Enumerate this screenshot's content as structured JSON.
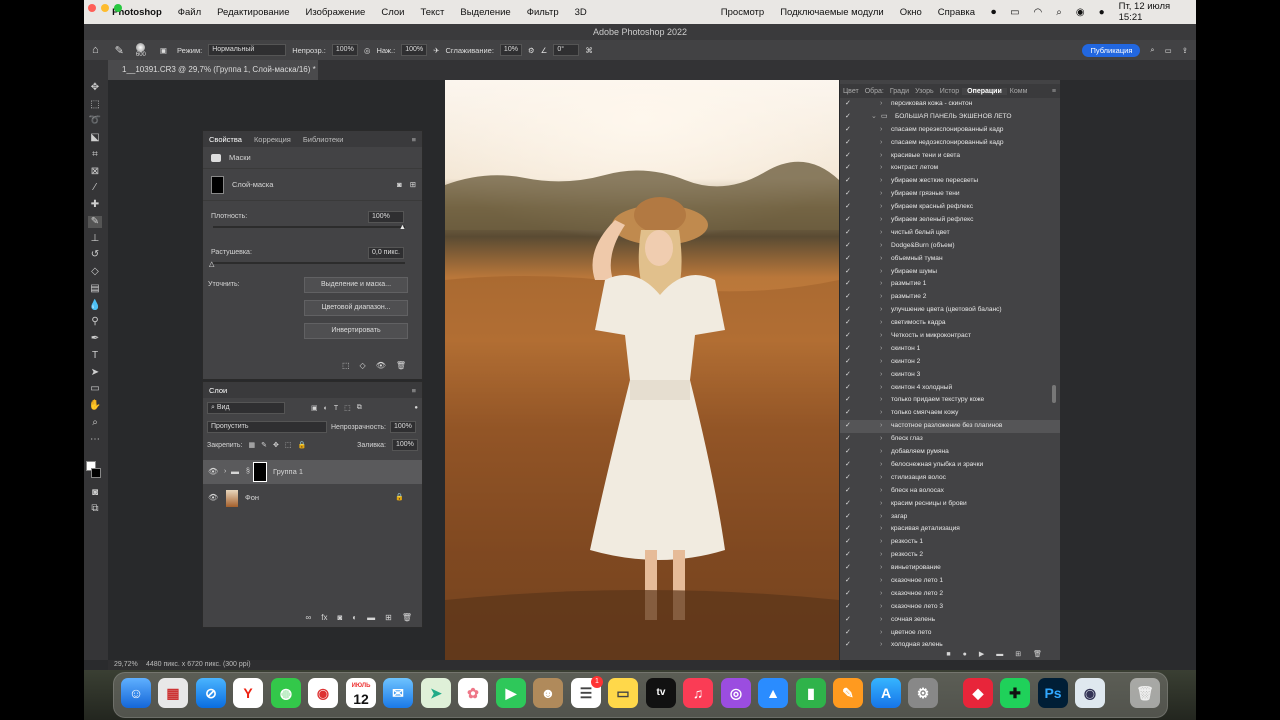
{
  "menubar": {
    "app": "Photoshop",
    "items": [
      "Файл",
      "Редактирование",
      "Изображение",
      "Слои",
      "Текст",
      "Выделение",
      "Фильтр",
      "3D",
      "Просмотр",
      "Подключаемые модули",
      "Окно",
      "Справка"
    ],
    "clock": "Пт, 12 июля  15:21"
  },
  "window": {
    "title": "Adobe Photoshop 2022"
  },
  "options": {
    "brush_size": "600",
    "mode_label": "Режим:",
    "mode_value": "Нормальный",
    "opacity_label": "Непрозр.:",
    "opacity_value": "100%",
    "pressure_label": "Наж.:",
    "pressure_value": "100%",
    "smoothing_label": "Сглаживание:",
    "smoothing_value": "10%",
    "angle_value": "0°",
    "publish": "Публикация"
  },
  "document": {
    "tab": "1__10391.CR3 @ 29,7% (Группа 1, Слой-маска/16) *"
  },
  "properties": {
    "tabs": [
      "Свойства",
      "Коррекция",
      "Библиотеки"
    ],
    "section": "Маски",
    "mask_label": "Слой-маска",
    "density_label": "Плотность:",
    "density_value": "100%",
    "feather_label": "Растушевка:",
    "feather_value": "0,0 пикс.",
    "refine_label": "Уточнить:",
    "btn_select_mask": "Выделение и маска...",
    "btn_color_range": "Цветовой диапазон...",
    "btn_invert": "Инвертировать"
  },
  "layers": {
    "tab": "Слои",
    "filter": "Вид",
    "blend": "Пропустить",
    "opacity_label": "Непрозрачность:",
    "opacity_value": "100%",
    "lock_label": "Закрепить:",
    "fill_label": "Заливка:",
    "fill_value": "100%",
    "rows": [
      {
        "name": "Группа 1"
      },
      {
        "name": "Фон"
      }
    ]
  },
  "actions_panel": {
    "tabs": [
      "Цвет",
      "Обра:",
      "Гради",
      "Узорь",
      "Истор",
      "Операции",
      "Комм"
    ],
    "set_name": "БОЛЬШАЯ ПАНЕЛЬ ЭКШЕНОВ ЛЕТО",
    "first_item": "персиковая кожа - скинтон",
    "items": [
      "спасаем переэкспонированный кадр",
      "спасаем недоэкспонированный кадр",
      "красивые тени и света",
      "контраст летом",
      "убираем  жесткие пересветы",
      "убираем грязные тени",
      "убираем красный рефлекс",
      "убираем зеленый рефлекс",
      "чистый белый цвет",
      "Dodge&Burn (объем)",
      "объемный туман",
      "убираем шумы",
      "размытие 1",
      "размытие 2",
      "улучшение цвета (цветовой баланс)",
      "светимость кадра",
      "Четкость и микроконтраст",
      "скинтон 1",
      "скинтон 2",
      "скинтон 3",
      "скинтон 4 холодный",
      "только придаем текстуру коже",
      "только смягчаем кожу",
      "частотное разложение без плагинов",
      "блеск глаз",
      "добавляем румяна",
      "белоснежная улыбка и зрачки",
      "стилизация волос",
      "блеск на волосах",
      "красим ресницы и брови",
      "загар",
      "красивая детализация",
      "резкость 1",
      "резкость 2",
      "виньетирование",
      "сказочное лето 1",
      "сказочное лето 2",
      "сказочное лето 3",
      "сочная зелень",
      "цветное лето",
      "холодная зелень"
    ],
    "selected_index": 23
  },
  "status": {
    "zoom": "29,72%",
    "info": "4480 пикс. x 6720 пикс. (300 ppi)"
  },
  "dock": {
    "calendar_month": "ИЮЛЬ",
    "calendar_day": "12",
    "reminders_badge": "1",
    "tv_label": "tv",
    "ps_label": "Ps"
  }
}
